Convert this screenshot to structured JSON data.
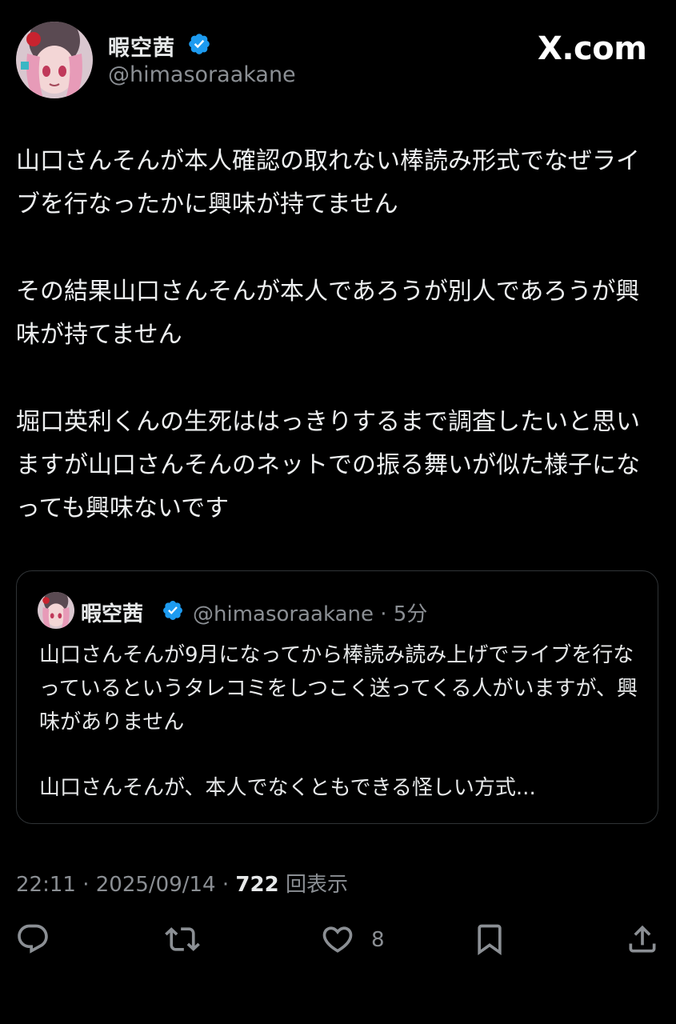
{
  "header": {
    "display_name": "暇空茜",
    "handle": "@himasoraakane",
    "brand": "X.com",
    "verified_color": "#1d9bf0"
  },
  "tweet": {
    "paragraphs": [
      "山口さんそんが本人確認の取れない棒読み形式でなぜライブを行なったかに興味が持てません",
      "その結果山口さんそんが本人であろうが別人であろうが興味が持てません",
      "堀口英利くんの生死ははっきりするまで調査したいと思いますが山口さんそんのネットでの振る舞いが似た様子になっても興味ないです"
    ]
  },
  "quote": {
    "display_name": "暇空茜",
    "handle": "@himasoraakane",
    "time": "5分",
    "text1": "山口さんそんが9月になってから棒読み読み上げでライブを行なっているというタレコミをしつこく送ってくる人がいますが、興味がありません",
    "text2": "山口さんそんが、本人でなくともできる怪しい方式..."
  },
  "meta": {
    "time": "22:11",
    "date": "2025/09/14",
    "views": "722",
    "views_label": "回表示"
  },
  "actions": {
    "like_count": "8",
    "icons": [
      "reply-icon",
      "retweet-icon",
      "heart-icon",
      "bookmark-icon",
      "share-icon"
    ]
  }
}
